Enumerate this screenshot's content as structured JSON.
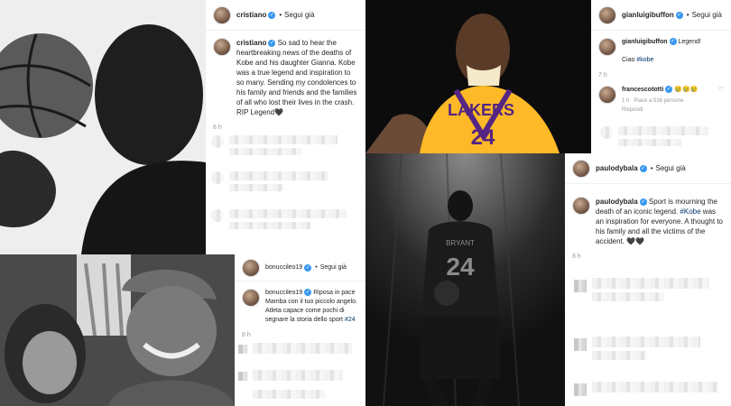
{
  "posts": {
    "cristiano": {
      "username": "cristiano",
      "follow": "Segui già",
      "caption": "So sad to hear the heartbreaking news of the deaths of Kobe and his daughter Gianna. Kobe was a true legend and inspiration to so many. Sending my condolences to his family and friends and the families of all who lost their lives in the crash. RIP Legend🖤",
      "time": "8 h"
    },
    "buffon": {
      "username": "gianluigibuffon",
      "follow": "Segui già",
      "caption_text": "Legend!",
      "caption_line2": "Ciao",
      "hashtag": "#kobe",
      "time": "7 h",
      "reply_user": "francescototti",
      "reply_text": "😢😢😢",
      "reply_meta1": "1 h",
      "reply_meta2": "Piace a 536 persone",
      "reply_meta3": "Rispondi"
    },
    "bonucci": {
      "username": "bonuccileo19",
      "follow": "Segui già",
      "caption": "Riposa in pace Mamba con il tuo piccolo angelo. Atleta capace come pochi di segnare la storia dello sport",
      "hashtag": "#24",
      "time": "8 h"
    },
    "dybala": {
      "username": "paulodybala",
      "follow": "Segui già",
      "caption_a": "Sport is mourning the death of an iconic legend.",
      "hashtag": "#Kobe",
      "caption_b": "was an inspiration for everyone. A thought to his family and all the victims of the accident. 🖤🖤",
      "time": "8 h"
    }
  },
  "jersey": {
    "lakers_text": "LAKERS",
    "number": "24",
    "back_name": "BRYANT",
    "back_number": "24"
  },
  "colors": {
    "verified": "#3897f0",
    "hashtag": "#003569",
    "lakers_gold": "#fdb927"
  }
}
